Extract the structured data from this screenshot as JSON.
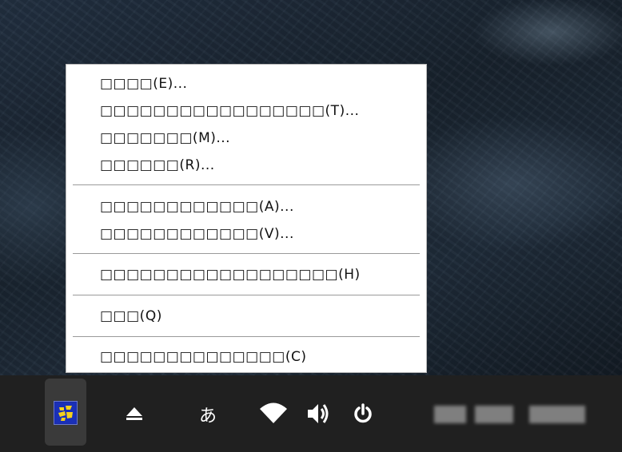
{
  "context_menu": {
    "items": [
      {
        "label": "□□□□(E)...",
        "group": 1
      },
      {
        "label": "□□□□□□□□□□□□□□□□□(T)...",
        "group": 1
      },
      {
        "label": "□□□□□□□(M)...",
        "group": 1
      },
      {
        "label": "□□□□□□(R)...",
        "group": 1
      },
      {
        "label": "□□□□□□□□□□□□(A)...",
        "group": 2
      },
      {
        "label": "□□□□□□□□□□□□(V)...",
        "group": 2
      },
      {
        "label": "□□□□□□□□□□□□□□□□□□(H)",
        "group": 3
      },
      {
        "label": "□□□(Q)",
        "group": 4
      },
      {
        "label": "□□□□□□□□□□□□□□(C)",
        "group": 5
      }
    ]
  },
  "taskbar": {
    "ime_glyph": "あ",
    "eject_icon": "⏏",
    "ime_tray_icon": "ime-tray-icon",
    "colors": {
      "background": "#202020",
      "menu_bg": "#ffffff"
    }
  }
}
